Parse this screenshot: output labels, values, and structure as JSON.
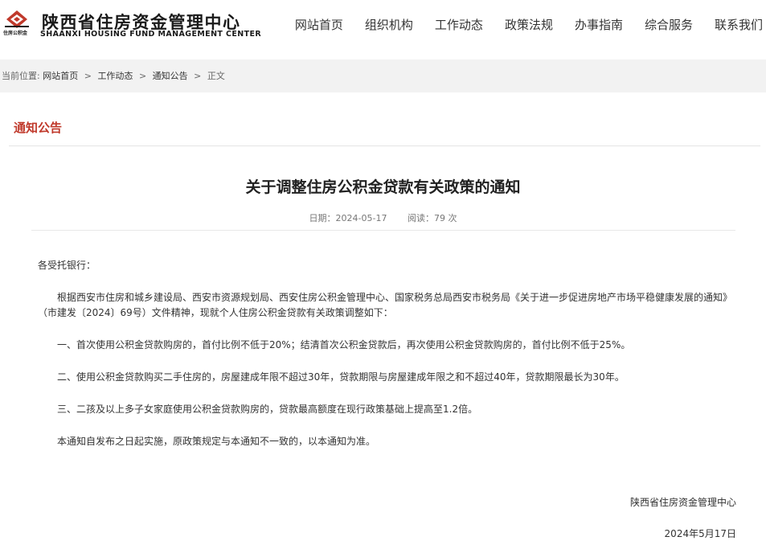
{
  "header": {
    "logo_cn": "陕西省住房资金管理中心",
    "logo_en": "SHAANXI HOUSING FUND MANAGEMENT CENTER",
    "logo_sub": "住房公积金",
    "logo_icon": "diamond-emblem-icon",
    "brand_color": "#c0392b"
  },
  "nav": {
    "items": [
      {
        "label": "网站首页"
      },
      {
        "label": "组织机构"
      },
      {
        "label": "工作动态"
      },
      {
        "label": "政策法规"
      },
      {
        "label": "办事指南"
      },
      {
        "label": "综合服务"
      },
      {
        "label": "联系我们"
      }
    ]
  },
  "breadcrumb": {
    "prefix": "当前位置:",
    "items": [
      {
        "label": "网站首页"
      },
      {
        "label": "工作动态"
      },
      {
        "label": "通知公告"
      },
      {
        "label": "正文"
      }
    ],
    "separator": ">"
  },
  "section": {
    "title": "通知公告"
  },
  "article": {
    "title": "关于调整住房公积金贷款有关政策的通知",
    "date_label": "日期：2024-05-17",
    "views_label": "阅读：79 次",
    "salutation": "各受托银行：",
    "paragraphs": [
      "根据西安市住房和城乡建设局、西安市资源规划局、西安住房公积金管理中心、国家税务总局西安市税务局《关于进一步促进房地产市场平稳健康发展的通知》（市建发〔2024〕69号）文件精神，现就个人住房公积金贷款有关政策调整如下：",
      "一、首次使用公积金贷款购房的，首付比例不低于20%；结清首次公积金贷款后，再次使用公积金贷款购房的，首付比例不低于25%。",
      "二、使用公积金贷款购买二手住房的，房屋建成年限不超过30年，贷款期限与房屋建成年限之和不超过40年，贷款期限最长为30年。",
      "三、二孩及以上多子女家庭使用公积金贷款购房的，贷款最高额度在现行政策基础上提高至1.2倍。",
      "本通知自发布之日起实施，原政策规定与本通知不一致的，以本通知为准。"
    ],
    "signature_org": "陕西省住房资金管理中心",
    "signature_date": "2024年5月17日"
  }
}
